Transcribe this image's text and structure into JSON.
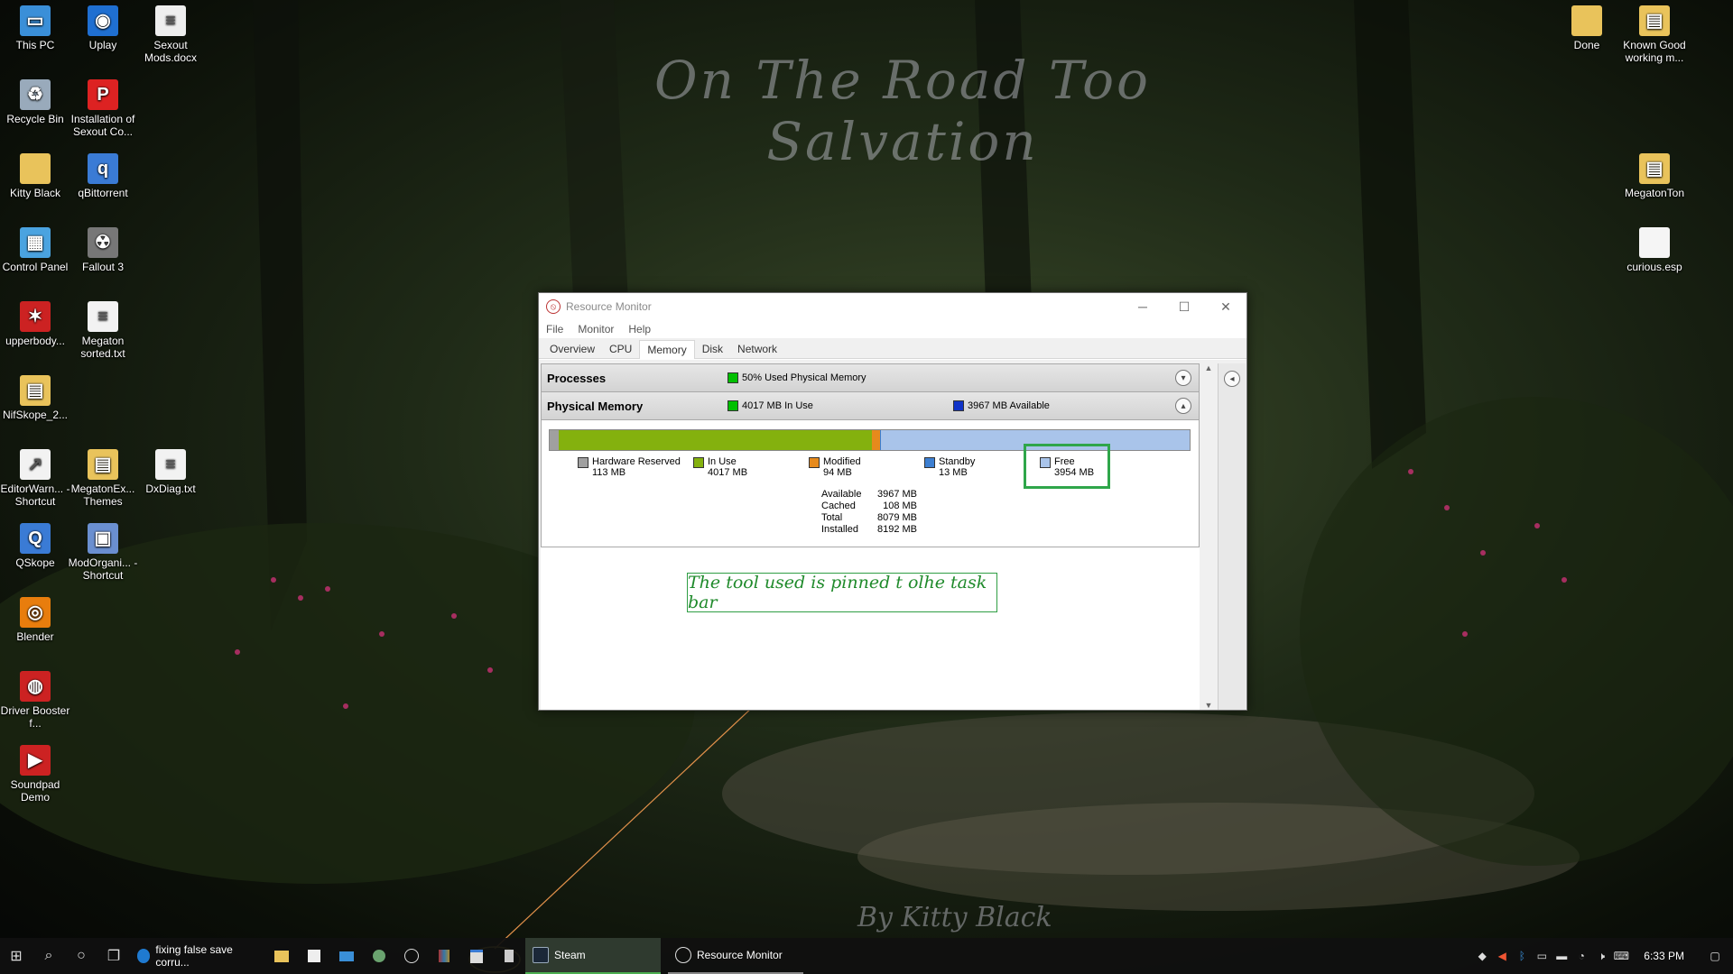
{
  "wallpaper": {
    "title": "On The Road Too Salvation",
    "signature": "By Kitty Black"
  },
  "desktop_icons_left": [
    {
      "label": "This PC",
      "icon": "this-pc-icon"
    },
    {
      "label": "Uplay",
      "icon": "uplay-icon"
    },
    {
      "label": "Sexout Mods.docx",
      "icon": "docx-file-icon"
    },
    {
      "label": "Recycle Bin",
      "icon": "recycle-bin-icon"
    },
    {
      "label": "Installation of Sexout Co...",
      "icon": "pdf-file-icon"
    },
    {
      "label": "Kitty Black",
      "icon": "folder-icon"
    },
    {
      "label": "qBittorrent",
      "icon": "qbittorrent-icon"
    },
    {
      "label": "Control Panel",
      "icon": "control-panel-icon"
    },
    {
      "label": "Fallout 3",
      "icon": "fallout3-icon"
    },
    {
      "label": "upperbody...",
      "icon": "red-splat-icon"
    },
    {
      "label": "Megaton sorted.txt",
      "icon": "text-file-icon"
    },
    {
      "label": "NifSkope_2...",
      "icon": "archive-icon"
    },
    {
      "label": "EditorWarn... - Shortcut",
      "icon": "shortcut-file-icon"
    },
    {
      "label": "MegatonEx... Themes",
      "icon": "archive-icon"
    },
    {
      "label": "DxDiag.txt",
      "icon": "text-file-icon"
    },
    {
      "label": "QSkope",
      "icon": "qskope-icon"
    },
    {
      "label": "ModOrgani... - Shortcut",
      "icon": "mod-organizer-icon"
    },
    {
      "label": "Blender",
      "icon": "blender-icon"
    },
    {
      "label": "Driver Booster f...",
      "icon": "driver-booster-icon"
    },
    {
      "label": "Soundpad Demo",
      "icon": "soundpad-icon"
    }
  ],
  "desktop_icons_right": [
    {
      "label": "Done",
      "icon": "folder-icon"
    },
    {
      "label": "Known Good working m...",
      "icon": "archive-icon"
    },
    {
      "label": "MegatonTon",
      "icon": "archive-icon"
    },
    {
      "label": "curious.esp",
      "icon": "file-icon"
    }
  ],
  "resource_monitor": {
    "title": "Resource Monitor",
    "menu": [
      "File",
      "Monitor",
      "Help"
    ],
    "tabs": [
      "Overview",
      "CPU",
      "Memory",
      "Disk",
      "Network"
    ],
    "active_tab": "Memory",
    "processes": {
      "title": "Processes",
      "stat": "50% Used Physical Memory",
      "color": "#00c000"
    },
    "physical_memory": {
      "title": "Physical Memory",
      "in_use_stat": "4017 MB In Use",
      "available_stat": "3967 MB Available",
      "bar": [
        {
          "name": "Hardware Reserved",
          "mb": 113,
          "color": "#a0a0a0"
        },
        {
          "name": "In Use",
          "mb": 4017,
          "color": "#84b10e"
        },
        {
          "name": "Modified",
          "mb": 94,
          "color": "#e68a1c"
        },
        {
          "name": "Standby",
          "mb": 13,
          "color": "#3d7fd1"
        },
        {
          "name": "Free",
          "mb": 3954,
          "color": "#a9c4ea"
        }
      ],
      "legend": [
        {
          "name": "Hardware Reserved",
          "value": "113 MB",
          "color": "#a0a0a0"
        },
        {
          "name": "In Use",
          "value": "4017 MB",
          "color": "#84b10e"
        },
        {
          "name": "Modified",
          "value": "94 MB",
          "color": "#e68a1c"
        },
        {
          "name": "Standby",
          "value": "13 MB",
          "color": "#3d7fd1"
        },
        {
          "name": "Free",
          "value": "3954 MB",
          "color": "#a9c4ea"
        }
      ],
      "totals": [
        {
          "k": "Available",
          "v": "3967 MB"
        },
        {
          "k": "Cached",
          "v": "108 MB"
        },
        {
          "k": "Total",
          "v": "8079 MB"
        },
        {
          "k": "Installed",
          "v": "8192 MB"
        }
      ]
    },
    "annotation": "The tool used is pinned t olhe task bar"
  },
  "taskbar": {
    "search_app_label": "fixing false save corru...",
    "steam_label": "Steam",
    "resource_monitor_label": "Resource Monitor",
    "clock": "6:33 PM"
  }
}
